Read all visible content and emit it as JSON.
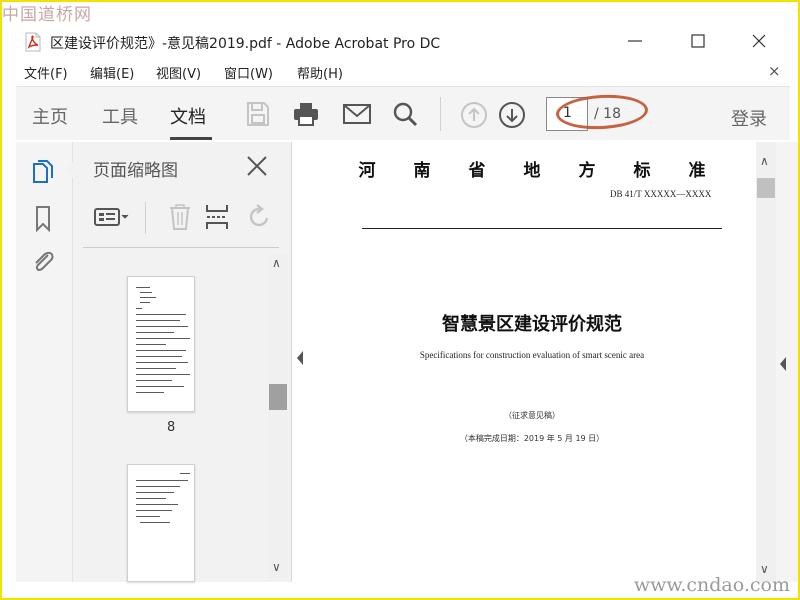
{
  "watermark": {
    "top_text": "中国道桥网",
    "bottom_text": "www.cndao.com"
  },
  "window": {
    "title": "区建设评价规范》-意见稿2019.pdf - Adobe Acrobat Pro DC"
  },
  "menu": {
    "items": [
      {
        "label": "文件(F)"
      },
      {
        "label": "编辑(E)"
      },
      {
        "label": "视图(V)"
      },
      {
        "label": "窗口(W)"
      },
      {
        "label": "帮助(H)"
      }
    ],
    "close_glyph": "×"
  },
  "toolbar": {
    "tabs": [
      {
        "label": "主页"
      },
      {
        "label": "工具"
      },
      {
        "label": "文档"
      }
    ],
    "page_current": "1",
    "page_total": "/ 18",
    "login_label": "登录"
  },
  "thumbnail_panel": {
    "title": "页面缩略图",
    "page_label": "8"
  },
  "document": {
    "standard_header": "河南省地方标准",
    "code": "DB 41/T XXXXX—XXXX",
    "title": "智慧景区建设评价规范",
    "subtitle": "Specifications for construction evaluation of smart scenic area",
    "draft_note": "（征求意见稿）",
    "completion_date": "（本稿完成日期：2019 年 5 月 19 日）"
  },
  "colors": {
    "frame_border": "#f2e200",
    "page_highlight": "#c0522d",
    "acrobat_red": "#d9281c",
    "active_icon_blue": "#1d6fc4"
  },
  "icons": {
    "app": "acrobat-pdf-icon",
    "toolbar": [
      "save-icon",
      "print-icon",
      "email-icon",
      "search-icon",
      "page-up-icon",
      "page-down-icon"
    ],
    "rail": [
      "page-thumbnails-icon",
      "bookmark-icon",
      "attachment-icon"
    ],
    "panel_tools": [
      "thumbnail-options-icon",
      "delete-page-icon",
      "insert-page-icon",
      "rotate-page-icon"
    ]
  }
}
